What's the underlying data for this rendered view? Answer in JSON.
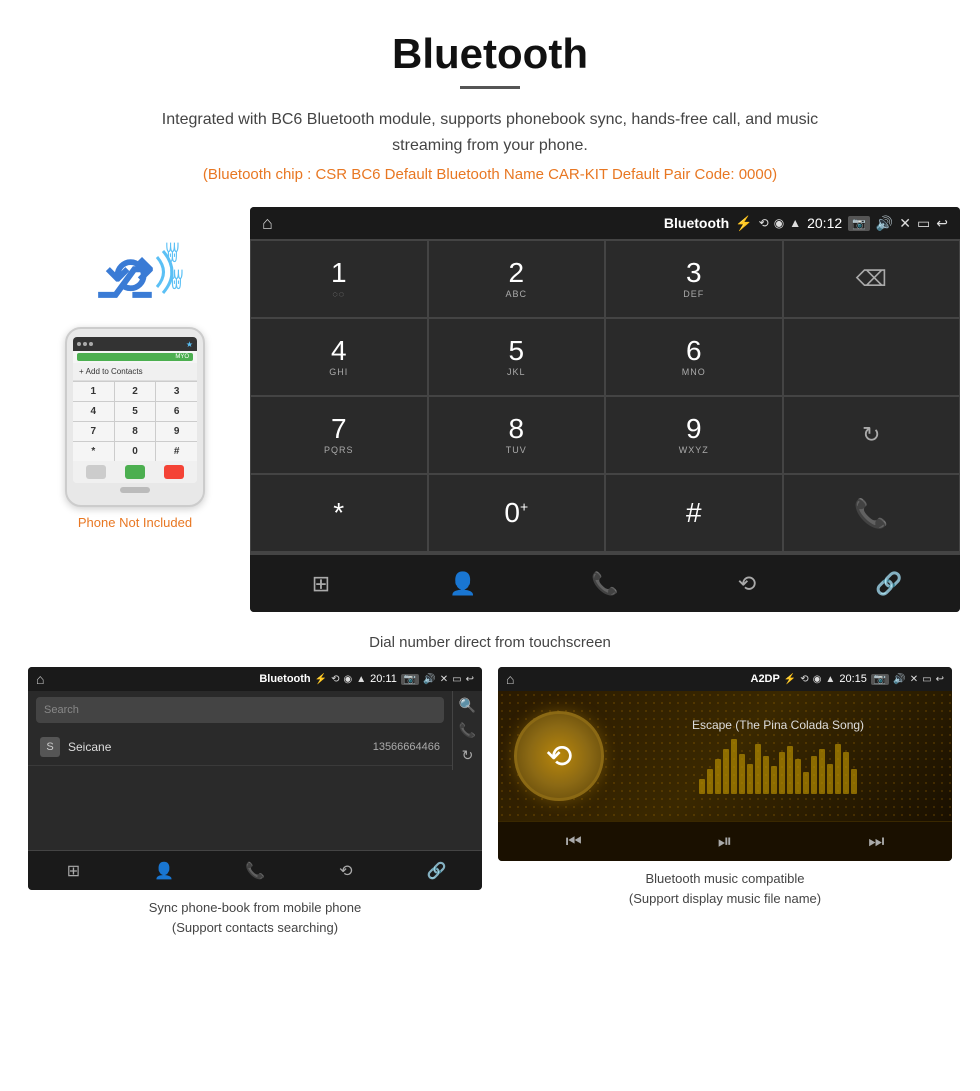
{
  "header": {
    "title": "Bluetooth",
    "subtitle": "Integrated with BC6 Bluetooth module, supports phonebook sync, hands-free call, and music streaming from your phone.",
    "spec_line": "(Bluetooth chip : CSR BC6    Default Bluetooth Name CAR-KIT    Default Pair Code: 0000)"
  },
  "phone_label": "Phone Not Included",
  "dialpad_screen": {
    "status_title": "Bluetooth",
    "status_time": "20:12",
    "caption": "Dial number direct from touchscreen",
    "keys": [
      {
        "num": "1",
        "sub": "◌◌"
      },
      {
        "num": "2",
        "sub": "ABC"
      },
      {
        "num": "3",
        "sub": "DEF"
      },
      {
        "num": "",
        "sub": ""
      },
      {
        "num": "4",
        "sub": "GHI"
      },
      {
        "num": "5",
        "sub": "JKL"
      },
      {
        "num": "6",
        "sub": "MNO"
      },
      {
        "num": "",
        "sub": ""
      },
      {
        "num": "7",
        "sub": "PQRS"
      },
      {
        "num": "8",
        "sub": "TUV"
      },
      {
        "num": "9",
        "sub": "WXYZ"
      },
      {
        "num": "",
        "sub": ""
      },
      {
        "num": "*",
        "sub": ""
      },
      {
        "num": "0",
        "sub": "+"
      },
      {
        "num": "#",
        "sub": ""
      },
      {
        "num": "",
        "sub": ""
      }
    ]
  },
  "phonebook_screen": {
    "status_title": "Bluetooth",
    "status_time": "20:11",
    "search_placeholder": "Search",
    "contact_letter": "S",
    "contact_name": "Seicane",
    "contact_phone": "13566664466",
    "caption_line1": "Sync phone-book from mobile phone",
    "caption_line2": "(Support contacts searching)"
  },
  "music_screen": {
    "status_title": "A2DP",
    "status_time": "20:15",
    "song_title": "Escape (The Pina Colada Song)",
    "eq_bars": [
      15,
      25,
      35,
      45,
      55,
      40,
      30,
      50,
      38,
      28,
      42,
      48,
      35,
      22,
      38,
      45,
      30,
      50,
      42,
      25
    ],
    "caption_line1": "Bluetooth music compatible",
    "caption_line2": "(Support display music file name)"
  },
  "colors": {
    "accent_orange": "#e87722",
    "call_green": "#4caf50",
    "call_red": "#f44336",
    "status_bar_bg": "#1a1a1a",
    "screen_bg": "#2a2a2a"
  }
}
